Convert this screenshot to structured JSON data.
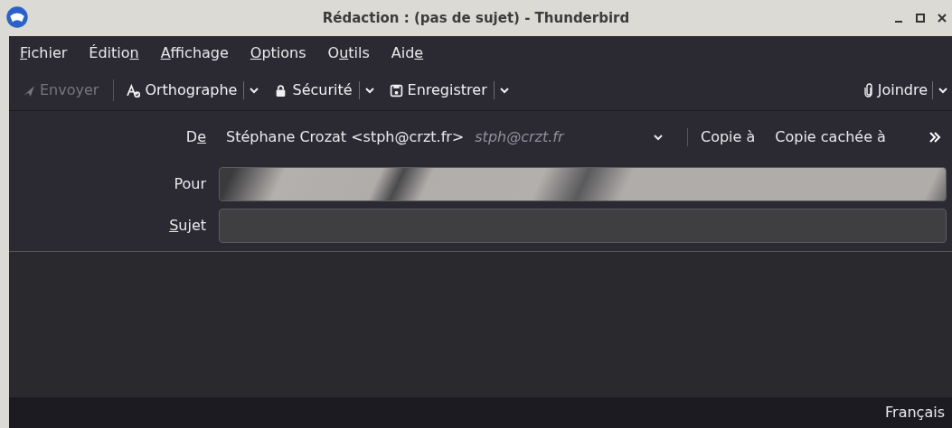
{
  "window": {
    "title": "Rédaction : (pas de sujet) - Thunderbird"
  },
  "menu_bar": [
    {
      "label": [
        {
          "text": "F",
          "underlined": true
        },
        {
          "text": "ichier",
          "underlined": false
        }
      ]
    },
    {
      "label": [
        {
          "text": "Éditio",
          "underlined": false
        },
        {
          "text": "n",
          "underlined": true
        }
      ]
    },
    {
      "label": [
        {
          "text": "A",
          "underlined": true
        },
        {
          "text": "ffichage",
          "underlined": false
        }
      ]
    },
    {
      "label": [
        {
          "text": "O",
          "underlined": true
        },
        {
          "text": "ptions",
          "underlined": false
        }
      ]
    },
    {
      "label": [
        {
          "text": "O",
          "underlined": false
        },
        {
          "text": "u",
          "underlined": true
        },
        {
          "text": "tils",
          "underlined": false
        }
      ]
    },
    {
      "label": [
        {
          "text": "Aid",
          "underlined": false
        },
        {
          "text": "e",
          "underlined": true
        }
      ]
    }
  ],
  "toolbar": [
    {
      "kind": "send",
      "label": "Envoyer",
      "disabled": true,
      "has_menu": false
    },
    {
      "kind": "spelling",
      "label": "Orthographe",
      "disabled": false,
      "has_menu": true
    },
    {
      "kind": "security",
      "label": "Sécurité",
      "disabled": false,
      "has_menu": true
    },
    {
      "kind": "save",
      "label": "Enregistrer",
      "disabled": false,
      "has_menu": true
    }
  ],
  "attach_button": {
    "label": "Joindre",
    "disabled": false,
    "has_menu": true
  },
  "from": {
    "label": [
      {
        "text": "D",
        "underlined": false
      },
      {
        "text": "e",
        "underlined": true
      }
    ],
    "value": "Stéphane Crozat <stph@crzt.fr>",
    "identity": "stph@crzt.fr"
  },
  "cc_links": [
    "Copie à",
    "Copie cachée à"
  ],
  "to": {
    "label": "Pour"
  },
  "subject": {
    "label": [
      {
        "text": "S",
        "underlined": true
      },
      {
        "text": "ujet",
        "underlined": false
      }
    ]
  },
  "status_bar": {
    "language": "Français"
  }
}
